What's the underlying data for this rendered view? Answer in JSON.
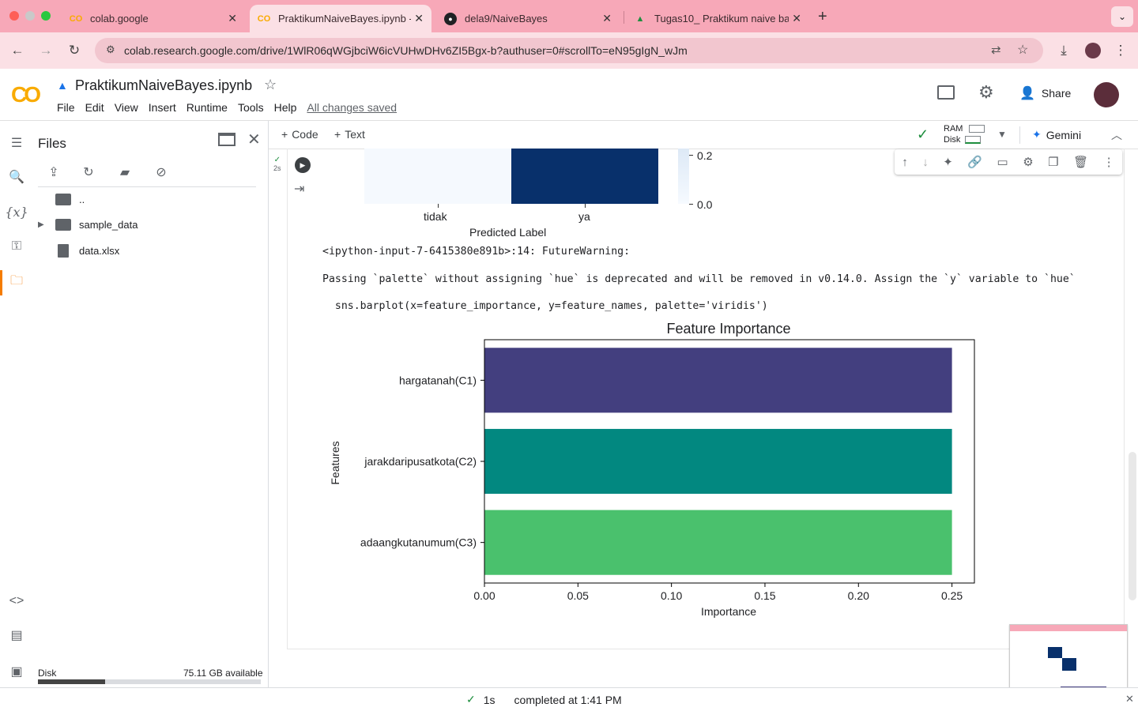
{
  "browser": {
    "tabs": [
      {
        "title": "colab.google",
        "icon": "colab-icon"
      },
      {
        "title": "PraktikumNaiveBayes.ipynb -",
        "icon": "colab-icon",
        "active": true
      },
      {
        "title": "dela9/NaiveBayes",
        "icon": "github-icon"
      },
      {
        "title": "Tugas10_ Praktikum naive ba",
        "icon": "drive-icon"
      }
    ],
    "url": "colab.research.google.com/drive/1WlR06qWGjbciW6icVUHwDHv6ZI5Bgx-b?authuser=0#scrollTo=eN95gIgN_wJm"
  },
  "colab": {
    "title": "PraktikumNaiveBayes.ipynb",
    "menus": [
      "File",
      "Edit",
      "View",
      "Insert",
      "Runtime",
      "Tools",
      "Help"
    ],
    "saved_status": "All changes saved",
    "share_label": "Share",
    "toolbar": {
      "code": "Code",
      "text": "Text",
      "ram": "RAM",
      "disk": "Disk",
      "gemini": "Gemini"
    }
  },
  "files": {
    "title": "Files",
    "items": [
      {
        "name": "..",
        "type": "folder-up"
      },
      {
        "name": "sample_data",
        "type": "folder"
      },
      {
        "name": "data.xlsx",
        "type": "file"
      }
    ],
    "disk_label": "Disk",
    "disk_available": "75.11 GB available",
    "disk_used_fraction": 0.3
  },
  "cell": {
    "exec_time": "2s",
    "confusion_matrix": {
      "x_ticks": [
        "tidak",
        "ya"
      ],
      "xlabel": "Predicted Label",
      "colorbar_ticks": [
        "0.2",
        "0.0"
      ]
    },
    "warning_line1": "<ipython-input-7-6415380e891b>:14: FutureWarning:",
    "warning_line2": "Passing `palette` without assigning `hue` is deprecated and will be removed in v0.14.0. Assign the `y` variable to `hue`",
    "warning_line3": "  sns.barplot(x=feature_importance, y=feature_names, palette='viridis')"
  },
  "chart_data": {
    "type": "bar",
    "orientation": "horizontal",
    "title": "Feature Importance",
    "xlabel": "Importance",
    "ylabel": "Features",
    "categories": [
      "hargatanah(C1)",
      "jarakdaripusatkota(C2)",
      "adaangkutanumum(C3)"
    ],
    "values": [
      0.25,
      0.25,
      0.25
    ],
    "colors": [
      "#433f7f",
      "#028880",
      "#4ac16d"
    ],
    "xlim": [
      0,
      0.262
    ],
    "x_ticks": [
      "0.00",
      "0.05",
      "0.10",
      "0.15",
      "0.20",
      "0.25"
    ],
    "grid": false
  },
  "status": {
    "time": "1s",
    "completed": "completed at 1:41 PM"
  }
}
